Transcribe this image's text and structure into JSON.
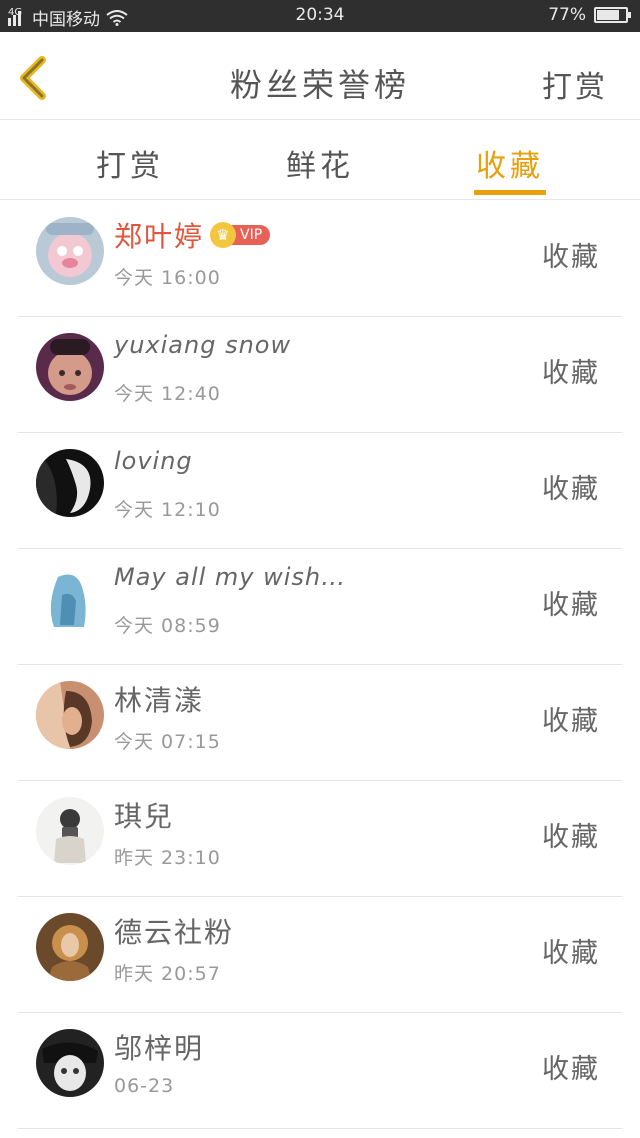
{
  "status_bar": {
    "network": "4G",
    "carrier": "中国移动",
    "time": "20:34",
    "battery_text": "77%",
    "battery_level": 0.77
  },
  "header": {
    "back_icon": "chevron-left-icon",
    "title": "粉丝荣誉榜",
    "action": "打赏"
  },
  "tabs": [
    {
      "label": "打赏",
      "active": false
    },
    {
      "label": "鲜花",
      "active": false
    },
    {
      "label": "收藏",
      "active": true
    }
  ],
  "colors": {
    "accent": "#e8a00c",
    "vip_name": "#e2553a",
    "vip_badge": "#e76156",
    "crown": "#f3c640",
    "status_bar_bg": "#2f2f2f"
  },
  "vip_badge_text": "VIP",
  "rows": [
    {
      "name": "郑叶婷",
      "time": "今天 16:00",
      "action": "收藏"
    },
    {
      "name": "yuxiang snow",
      "time": "今天 12:40",
      "action": "收藏"
    },
    {
      "name": "loving",
      "time": "今天 12:10",
      "action": "收藏"
    },
    {
      "name": "May all my wish…",
      "time": "今天 08:59",
      "action": "收藏"
    },
    {
      "name": "林清漾",
      "time": "今天 07:15",
      "action": "收藏"
    },
    {
      "name": "琪兒",
      "time": "昨天 23:10",
      "action": "收藏"
    },
    {
      "name": "德云社粉",
      "time": "昨天 20:57",
      "action": "收藏"
    },
    {
      "name": "邬梓明",
      "time": "06-23",
      "action": "收藏"
    }
  ]
}
